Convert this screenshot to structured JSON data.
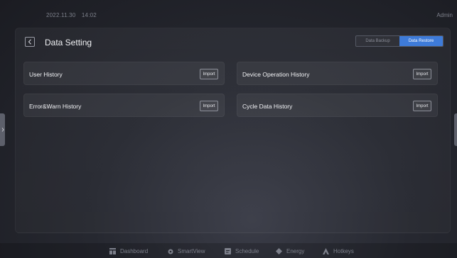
{
  "topbar": {
    "date": "2022.11.30",
    "time": "14:02",
    "user": "Admin"
  },
  "header": {
    "title": "Data Setting",
    "back_icon": "chevron-left-icon",
    "segments": [
      {
        "label": "Data Backup",
        "active": false
      },
      {
        "label": "Data Restore",
        "active": true
      }
    ]
  },
  "cards": [
    {
      "label": "User History",
      "button": "Import"
    },
    {
      "label": "Device Operation History",
      "button": "Import"
    },
    {
      "label": "Error&Warn History",
      "button": "Import"
    },
    {
      "label": "Cycle Data History",
      "button": "Import"
    }
  ],
  "bottom_nav": [
    {
      "label": "Dashboard",
      "icon": "dashboard-icon"
    },
    {
      "label": "SmartView",
      "icon": "smartview-icon"
    },
    {
      "label": "Schedule",
      "icon": "schedule-icon"
    },
    {
      "label": "Energy",
      "icon": "energy-icon"
    },
    {
      "label": "Hotkeys",
      "icon": "hotkeys-icon"
    }
  ],
  "colors": {
    "accent": "#3e7bd9",
    "background": "#23252c",
    "text": "#f2f3f6",
    "muted": "#7d808b"
  }
}
